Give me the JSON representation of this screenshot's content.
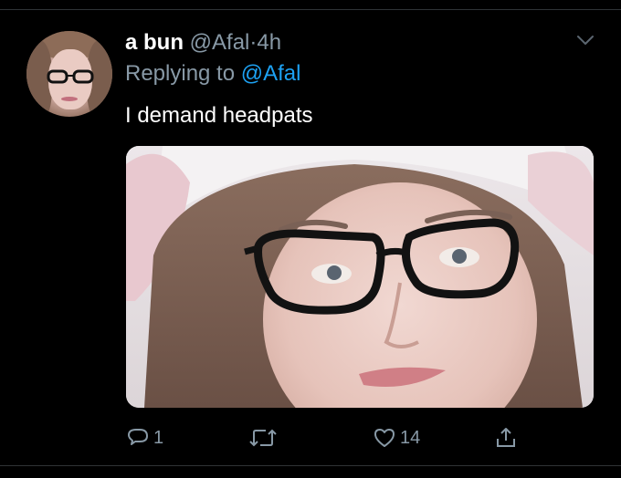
{
  "tweet": {
    "display_name": "a bun",
    "handle": "@Afal",
    "separator": "·",
    "time": "4h",
    "replying_label": "Replying to",
    "replying_handle": "@Afal",
    "text": "I demand headpats"
  },
  "actions": {
    "reply_count": "1",
    "retweet_count": "",
    "like_count": "14"
  },
  "icons": {
    "chevron": "chevron-down-icon",
    "reply": "reply-icon",
    "retweet": "retweet-icon",
    "like": "heart-icon",
    "share": "share-icon"
  },
  "colors": {
    "background": "#000000",
    "muted_text": "#8899a6",
    "link": "#1da1f2",
    "divider": "#2f3336"
  }
}
